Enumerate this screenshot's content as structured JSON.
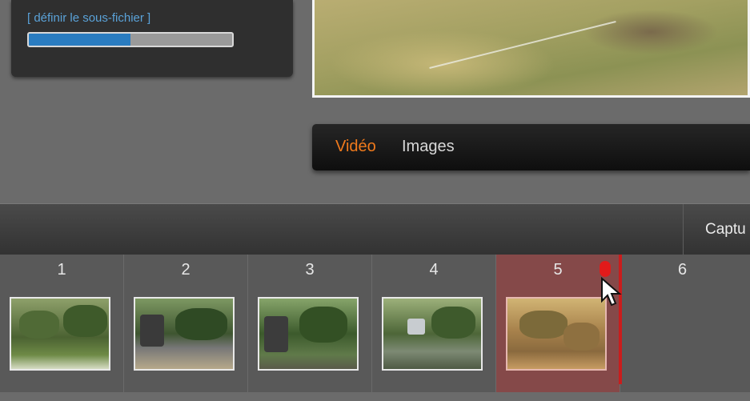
{
  "subfile": {
    "label": "[ définir le sous-fichier ]",
    "progress_percent": 50
  },
  "media_tabs": [
    {
      "label": "Vidéo",
      "active": true
    },
    {
      "label": "Images",
      "active": false
    }
  ],
  "capture": {
    "label": "Captu"
  },
  "timeline": {
    "slots": [
      {
        "number": "1",
        "has_thumbnail": true,
        "active": false
      },
      {
        "number": "2",
        "has_thumbnail": true,
        "active": false
      },
      {
        "number": "3",
        "has_thumbnail": true,
        "active": false
      },
      {
        "number": "4",
        "has_thumbnail": true,
        "active": false
      },
      {
        "number": "5",
        "has_thumbnail": true,
        "active": true
      },
      {
        "number": "6",
        "has_thumbnail": false,
        "active": false
      }
    ]
  },
  "colors": {
    "accent_orange": "#f07a1c",
    "progress_blue": "#2a7cc0",
    "playhead_red": "#c91d1d"
  },
  "icons": [
    "record-icon",
    "mouse-pointer-icon"
  ]
}
